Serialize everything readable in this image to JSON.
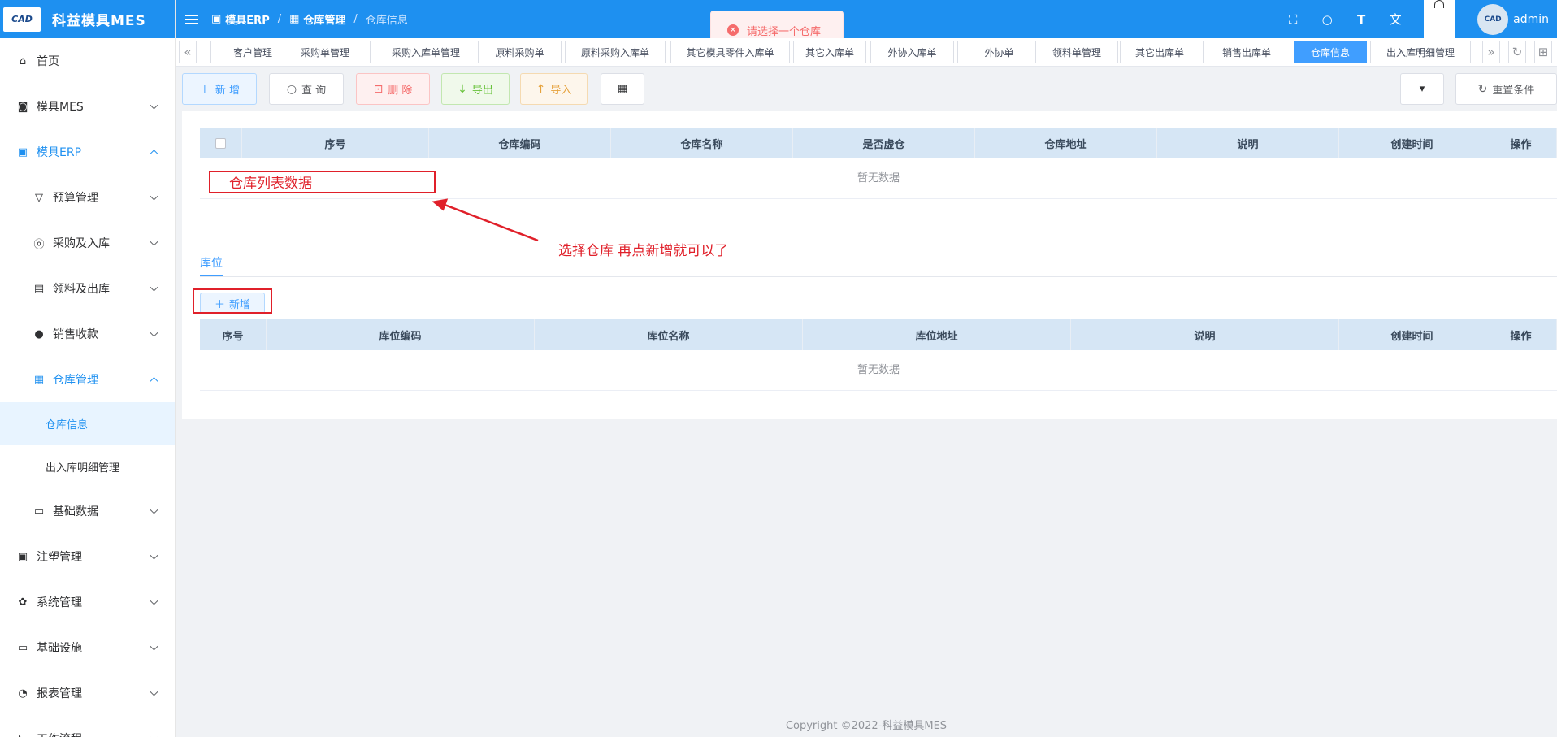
{
  "app": {
    "logo_text": "科益模具MES",
    "logo_badge": "CAD"
  },
  "sidebar": {
    "items": [
      {
        "label": "首页"
      },
      {
        "label": "模具MES"
      },
      {
        "label": "模具ERP"
      },
      {
        "label": "预算管理"
      },
      {
        "label": "采购及入库"
      },
      {
        "label": "领料及出库"
      },
      {
        "label": "销售收款"
      },
      {
        "label": "仓库管理"
      },
      {
        "label": "仓库信息"
      },
      {
        "label": "出入库明细管理"
      },
      {
        "label": "基础数据"
      },
      {
        "label": "注塑管理"
      },
      {
        "label": "系统管理"
      },
      {
        "label": "基础设施"
      },
      {
        "label": "报表管理"
      },
      {
        "label": "工作流程"
      }
    ]
  },
  "header": {
    "breadcrumb": [
      "模具ERP",
      "仓库管理",
      "仓库信息"
    ],
    "user": "admin"
  },
  "toast": {
    "message": "请选择一个仓库"
  },
  "tags": [
    {
      "label": "客户管理"
    },
    {
      "label": "采购单管理"
    },
    {
      "label": "采购入库单管理"
    },
    {
      "label": "原料采购单"
    },
    {
      "label": "原料采购入库单"
    },
    {
      "label": "其它模具零件入库单"
    },
    {
      "label": "其它入库单"
    },
    {
      "label": "外协入库单"
    },
    {
      "label": "外协单"
    },
    {
      "label": "领料单管理"
    },
    {
      "label": "其它出库单"
    },
    {
      "label": "销售出库单"
    },
    {
      "label": "仓库信息"
    },
    {
      "label": "出入库明细管理"
    }
  ],
  "toolbar": {
    "add": "新 增",
    "query": "查 询",
    "delete": "删 除",
    "export": "导出",
    "import": "导入",
    "reset": "重置条件"
  },
  "warehouse_table": {
    "columns": [
      "序号",
      "仓库编码",
      "仓库名称",
      "是否虚仓",
      "仓库地址",
      "说明",
      "创建时间",
      "操作"
    ],
    "empty_text": "暂无数据"
  },
  "location_section": {
    "tab": "库位",
    "add_label": "新增",
    "columns": [
      "序号",
      "库位编码",
      "库位名称",
      "库位地址",
      "说明",
      "创建时间",
      "操作"
    ],
    "empty_text": "暂无数据"
  },
  "annotations": {
    "box_label": "仓库列表数据",
    "arrow_note": "选择仓库 再点新增就可以了"
  },
  "footer": {
    "copyright": "Copyright ©2022-科益模具MES"
  },
  "colors": {
    "primary": "#1e90f0",
    "annotation": "#e0202a",
    "table_header": "#d6e6f5"
  }
}
